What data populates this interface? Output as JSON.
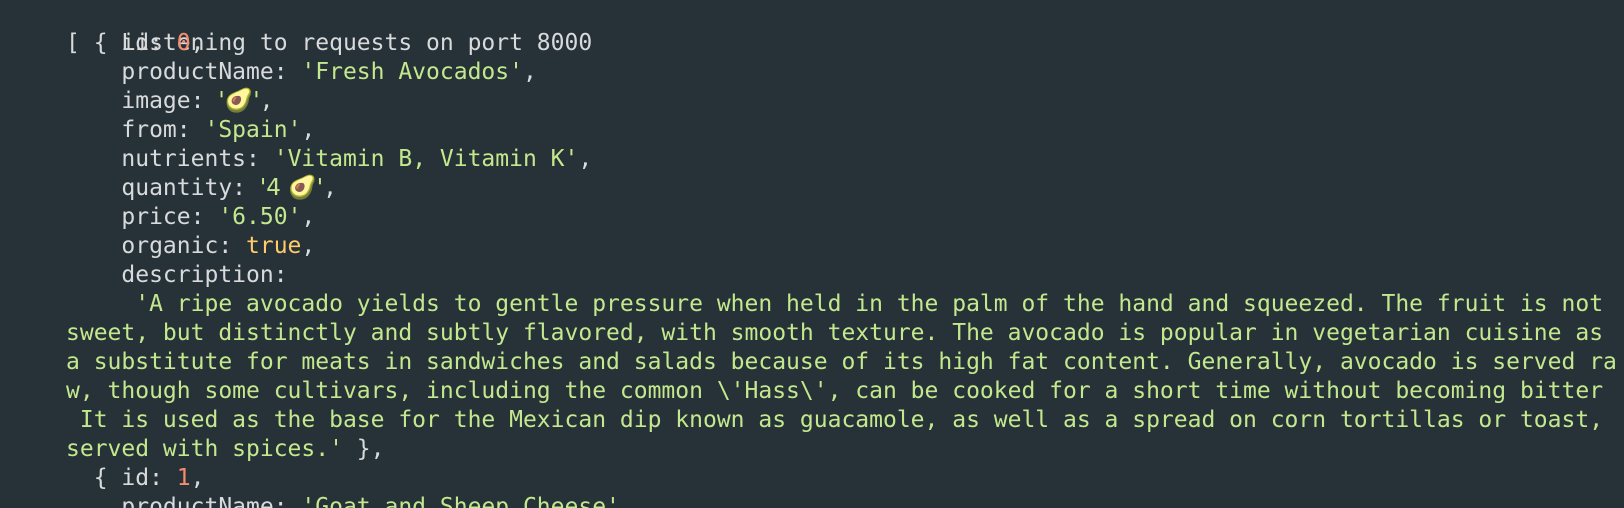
{
  "terminal": {
    "status_line": "Listening to requests on port 8000",
    "avocado_emoji_name": "avocado-icon",
    "colors": {
      "background": "#263238",
      "text": "#d8dadc",
      "string": "#c3e88d",
      "number": "#f78c6c",
      "boolean": "#ffcb6b"
    },
    "product0": {
      "open": "[ { id: ",
      "id": "0",
      "id_comma": ",",
      "name_key": "    productName: ",
      "name_val": "'Fresh Avocados'",
      "name_comma": ",",
      "image_key": "    image: ",
      "image_val": "'🥑'",
      "image_comma": ",",
      "from_key": "    from: ",
      "from_val": "'Spain'",
      "from_comma": ",",
      "nutrients_key": "    nutrients: ",
      "nutrients_val": "'Vitamin B, Vitamin K'",
      "nutrients_comma": ",",
      "quantity_key": "    quantity: ",
      "quantity_val": "'4 🥑'",
      "quantity_comma": ",",
      "price_key": "    price: ",
      "price_val": "'6.50'",
      "price_comma": ",",
      "organic_key": "    organic: ",
      "organic_val": "true",
      "organic_comma": ",",
      "description_key": "    description:",
      "description_lines": [
        "     'A ripe avocado yields to gentle pressure when held in the palm of the hand and squeezed. The fruit is not",
        "sweet, but distinctly and subtly flavored, with smooth texture. The avocado is popular in vegetarian cuisine as",
        "a substitute for meats in sandwiches and salads because of its high fat content. Generally, avocado is served ra",
        "w, though some cultivars, including the common \\'Hass\\', can be cooked for a short time without becoming bitter",
        " It is used as the base for the Mexican dip known as guacamole, as well as a spread on corn tortillas or toast,",
        "served with spices.'"
      ],
      "close": " },"
    },
    "product1": {
      "open": "  { id: ",
      "id": "1",
      "id_comma": ",",
      "name_key": "    productName: ",
      "name_val": "'Goat and Sheep Cheese'",
      "name_comma": ","
    }
  }
}
